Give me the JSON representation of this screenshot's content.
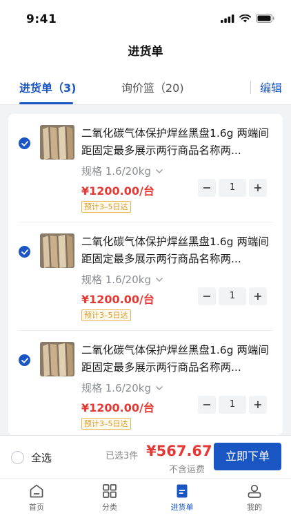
{
  "status": {
    "time": "9:41"
  },
  "nav": {
    "title": "进货单"
  },
  "tabs": {
    "active": "进货单（3)",
    "inactive": "询价篮（20)",
    "edit": "编辑"
  },
  "items": [
    {
      "title": "二氧化碳气体保护焊丝黑盘1.6g 两端间距固定最多展示两行商品名称两...",
      "spec": "规格 1.6/20kg",
      "price": "¥1200.00/台",
      "eta": "预计3–5日达",
      "qty": "1"
    },
    {
      "title": "二氧化碳气体保护焊丝黑盘1.6g 两端间距固定最多展示两行商品名称两...",
      "spec": "规格 1.6/20kg",
      "price": "¥1200.00/台",
      "eta": "预计3–5日达",
      "qty": "1"
    },
    {
      "title": "二氧化碳气体保护焊丝黑盘1.6g 两端间距固定最多展示两行商品名称两...",
      "spec": "规格 1.6/20kg",
      "price": "¥1200.00/台",
      "eta": "预计3–5日达",
      "qty": "1"
    }
  ],
  "footer": {
    "select_all": "全选",
    "selected_count": "已选3件",
    "total": "¥567.67",
    "shipping_note": "不含运费",
    "order_button": "立即下单"
  },
  "tabbar": [
    {
      "label": "首页",
      "icon": "home-icon",
      "active": false
    },
    {
      "label": "分类",
      "icon": "grid-icon",
      "active": false
    },
    {
      "label": "进货单",
      "icon": "document-icon",
      "active": true
    },
    {
      "label": "我的",
      "icon": "user-icon",
      "active": false
    }
  ],
  "colors": {
    "primary": "#1a55c4",
    "price": "#e53935",
    "eta": "#d89a25"
  }
}
